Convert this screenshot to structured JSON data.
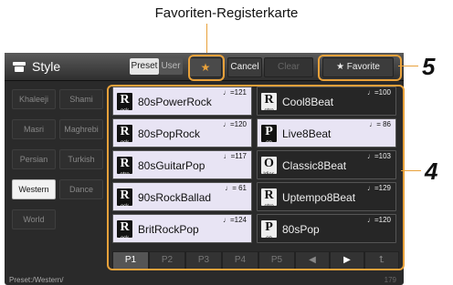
{
  "caption": "Favoriten-Registerkarte",
  "app": {
    "title": "Style"
  },
  "toolbar": {
    "preset_label": "Preset",
    "user_label": "User",
    "favorite_star": "★",
    "cancel_label": "Cancel",
    "clear_label": "Clear",
    "favorite_label": "★ Favorite"
  },
  "categories": [
    "Khaleeji",
    "Shami",
    "Masri",
    "Maghrebi",
    "Persian",
    "Turkish",
    "Western",
    "Dance",
    "World"
  ],
  "selected_category": "Western",
  "styles": [
    {
      "name": "80sPowerRock",
      "tempo": "♩=121",
      "badge_top": "R",
      "badge_sub": "ock"
    },
    {
      "name": "Cool8Beat",
      "tempo": "♩=100",
      "badge_top": "R",
      "badge_sub": "etro pop"
    },
    {
      "name": "80sPopRock",
      "tempo": "♩=120",
      "badge_top": "R",
      "badge_sub": "ock"
    },
    {
      "name": "Live8Beat",
      "tempo": "♩= 86",
      "badge_top": "P",
      "badge_sub": "op"
    },
    {
      "name": "80sGuitarPop",
      "tempo": "♩=117",
      "badge_top": "R",
      "badge_sub": "etro pop"
    },
    {
      "name": "Classic8Beat",
      "tempo": "♩=103",
      "badge_top": "O",
      "badge_sub": "ldies"
    },
    {
      "name": "90sRockBallad",
      "tempo": "♩= 61",
      "badge_top": "R",
      "badge_sub": "ock"
    },
    {
      "name": "Uptempo8Beat",
      "tempo": "♩=129",
      "badge_top": "R",
      "badge_sub": "etro pop"
    },
    {
      "name": "BritRockPop",
      "tempo": "♩=124",
      "badge_top": "R",
      "badge_sub": "ock"
    },
    {
      "name": "80sPop",
      "tempo": "♩=120",
      "badge_top": "P",
      "badge_sub": "op"
    }
  ],
  "pages": [
    "P1",
    "P2",
    "P3",
    "P4",
    "P5"
  ],
  "selected_page": "P1",
  "nav": {
    "prev": "◀",
    "next": "▶",
    "up": "⮤"
  },
  "status": {
    "path": "Preset:/Western/",
    "count": "179"
  },
  "callouts": {
    "five": "5",
    "four": "4"
  },
  "colors": {
    "highlight": "#e8a13a",
    "selected_cell": "#e8e4f4"
  }
}
